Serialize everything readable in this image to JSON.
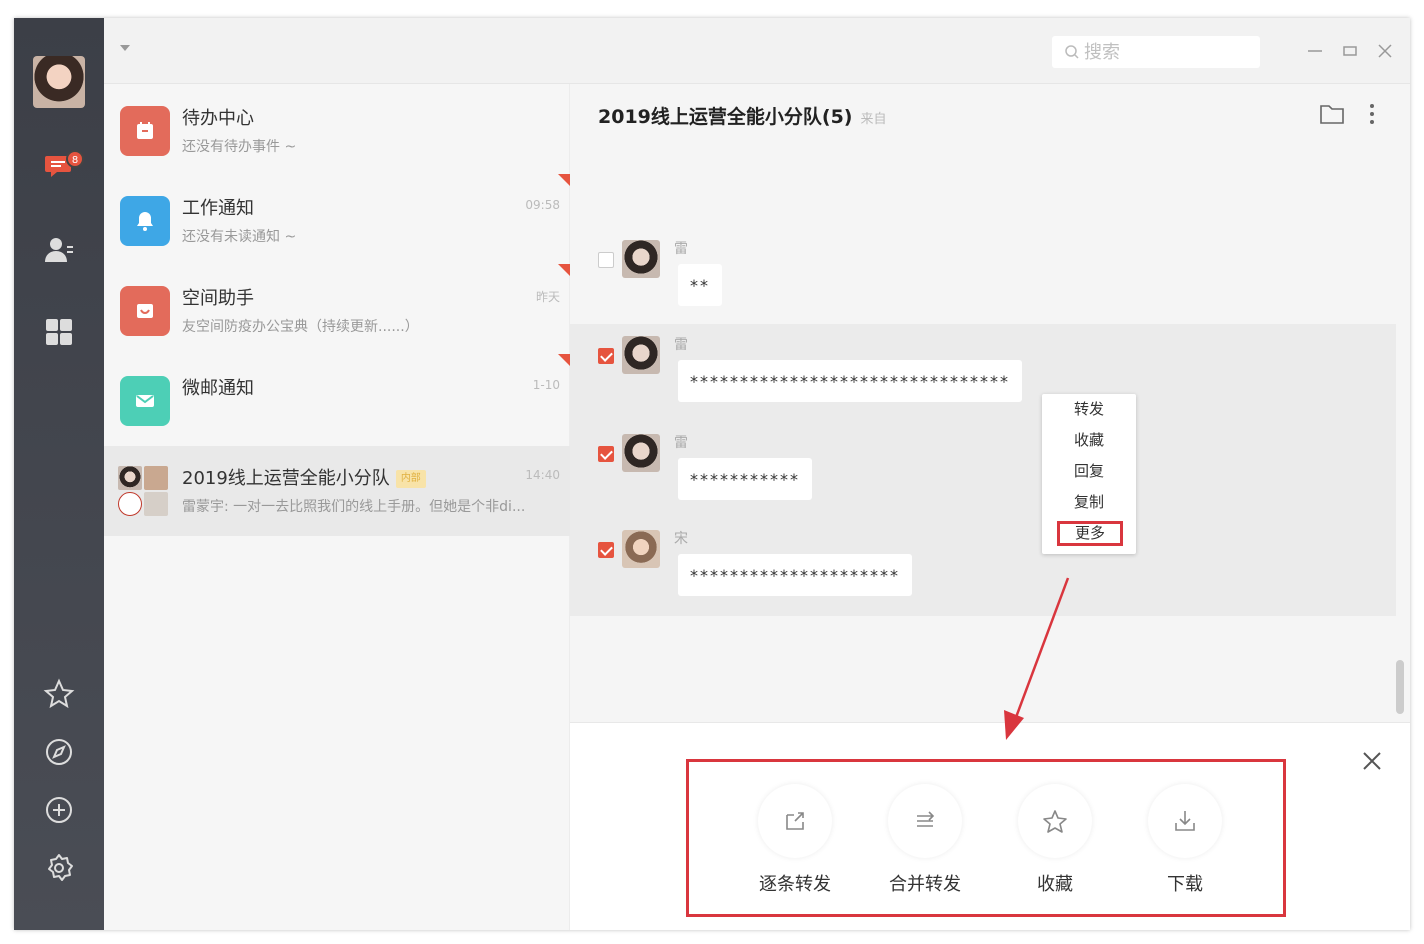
{
  "search": {
    "placeholder": "搜索"
  },
  "rail": {
    "badge": "8"
  },
  "conversations": [
    {
      "title": "待办中心",
      "subtitle": "还没有待办事件 ~",
      "time": "",
      "color": "#e36b5b"
    },
    {
      "title": "工作通知",
      "subtitle": "还没有未读通知 ~",
      "time": "09:58",
      "color": "#3ea7e6"
    },
    {
      "title": "空间助手",
      "subtitle": "友空间防疫办公宝典（持续更新......）",
      "time": "昨天",
      "color": "#e36b5b"
    },
    {
      "title": "微邮通知",
      "subtitle": "",
      "time": "1-10",
      "color": "#4dcfb6"
    },
    {
      "title": "2019线上运营全能小分队",
      "tag": "内部",
      "subtitle": "雷蒙宇: 一对一去比照我们的线上手册。但她是个非di...",
      "time": "14:40"
    }
  ],
  "chat": {
    "title": "2019线上运营全能小分队(5)",
    "subtitle": "来自",
    "messages": [
      {
        "name": "雷",
        "text": "**"
      },
      {
        "name": "雷",
        "text": "********************************"
      },
      {
        "name": "雷",
        "text": "***********"
      },
      {
        "name": "宋",
        "text": "*********************"
      }
    ],
    "context_menu": [
      "转发",
      "收藏",
      "回复",
      "复制",
      "更多"
    ],
    "actions": [
      "逐条转发",
      "合并转发",
      "收藏",
      "下载"
    ]
  },
  "colors": {
    "accent": "#d9363e",
    "check": "#e6543f"
  }
}
